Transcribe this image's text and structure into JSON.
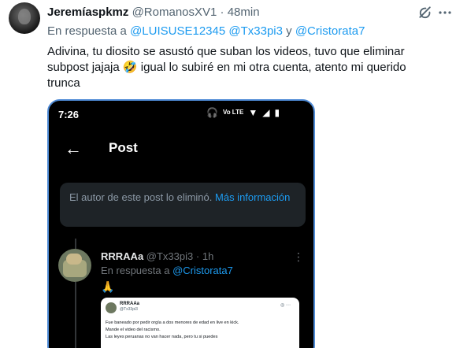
{
  "author": {
    "name": "Jeremíaspkmz",
    "handle": "@RomanosXV1",
    "separator": "·",
    "time": "48min"
  },
  "reply": {
    "prefix": "En respuesta a",
    "mention1": "@LUISUSE12345",
    "mention2": "@Tx33pi3",
    "conjunction": "y",
    "mention3": "@Cristorata7"
  },
  "tweet_text": "Adivina, tu diosito se asustó que suban los videos, tuvo que eliminar subpost jajaja 🤣 igual lo subiré en mi otra cuenta, atento mi querido trunca",
  "icons": {
    "grok": "grok-icon",
    "more": "more-icon"
  },
  "media": {
    "status_time": "7:26",
    "volte": "Vo LTE",
    "nav_title": "Post",
    "deleted_text": "El autor de este post lo eliminó.",
    "deleted_link": "Más información",
    "sub_tweet": {
      "name": "RRRAAa",
      "handle": "@Tx33pi3",
      "separator": "·",
      "time": "1h",
      "reply_prefix": "En respuesta a",
      "reply_mention": "@Cristorata7",
      "emoji": "🙏"
    },
    "inner_card": {
      "name": "RRRAAa",
      "handle": "@Tx33pi3",
      "line1": "Fue baneado por pedir orgía a dos menores de edad en live en kick.",
      "line2": "Mande el video del racismo.",
      "line3": "Las leyes peruanas no van hacer nada, pero tu si puedes"
    }
  },
  "colors": {
    "link_blue": "#1d9bf0",
    "secondary_text": "#536471",
    "media_border": "#4f8bd6"
  }
}
